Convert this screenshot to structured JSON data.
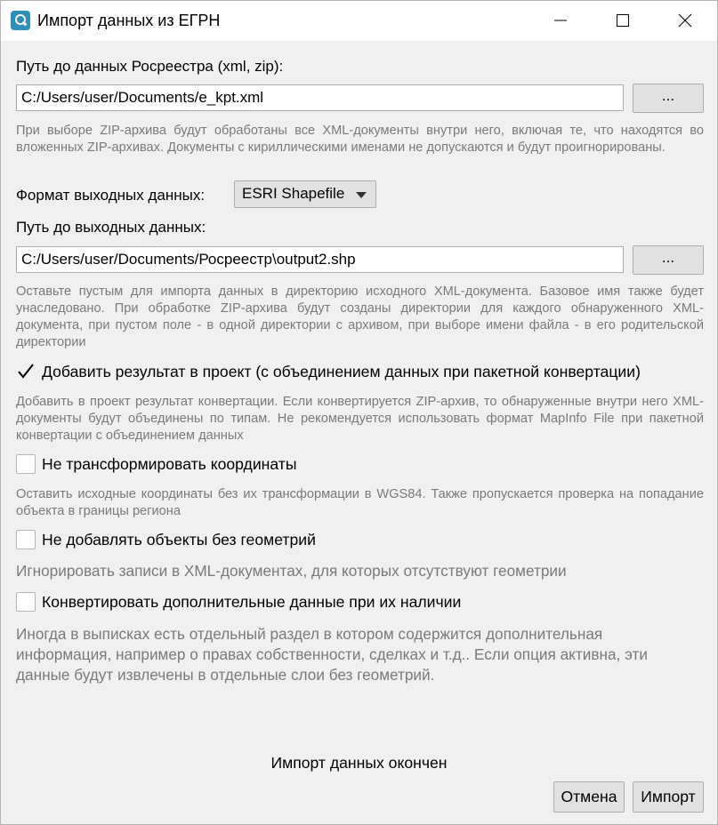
{
  "window": {
    "title": "Импорт данных из ЕГРН",
    "icon": "qgis-app-icon"
  },
  "input_path": {
    "label": "Путь до данных Росреестра (xml, zip):",
    "value": "C:/Users/user/Documents/e_kpt.xml",
    "browse_label": "...",
    "hint": "При выборе ZIP-архива будут обработаны все XML-документы внутри него, включая те, что находятся во вложенных ZIP-архивах. Документы с кириллическими именами не допускаются и будут проигнорированы."
  },
  "output_format": {
    "label": "Формат выходных данных:",
    "selected": "ESRI Shapefile"
  },
  "output_path": {
    "label": "Путь до выходных данных:",
    "value": "C:/Users/user/Documents/Росреестр\\output2.shp",
    "browse_label": "...",
    "hint": "Оставьте пустым для импорта данных в директорию исходного XML-документа. Базовое имя также будет унаследовано. При обработке ZIP-архива будут созданы директории для каждого обнаруженного XML-документа, при пустом поле - в одной директории с архивом, при выборе имени файла - в его родительской директории"
  },
  "options": [
    {
      "label": "Добавить результат в проект (с объединением данных при пакетной конвертации)",
      "checked": true,
      "hint": "Добавить в проект результат конвертации. Если конвертируется ZIP-архив, то обнаруженные внутри него XML-документы будут объединены по типам. Не рекомендуется использовать формат MapInfo File при пакетной конвертации с объединением данных"
    },
    {
      "label": "Не трансформировать координаты",
      "checked": false,
      "hint": "Оставить исходные координаты без их трансформации в WGS84. Также пропускается проверка на попадание объекта в границы региона"
    },
    {
      "label": "Не добавлять объекты без геометрий",
      "checked": false,
      "hint": "Игнорировать записи в XML-документах, для которых отсутствуют геометрии"
    },
    {
      "label": "Конвертировать дополнительные данные при их наличии",
      "checked": false,
      "hint": "Иногда в выписках есть отдельный раздел в котором содержится дополнительная информация, например о правах собственности, сделках и т.д.. Если опция активна, эти данные будут извлечены в отдельные слои без геометрий."
    }
  ],
  "status": "Импорт данных окончен",
  "buttons": {
    "cancel": "Отмена",
    "import": "Импорт"
  }
}
